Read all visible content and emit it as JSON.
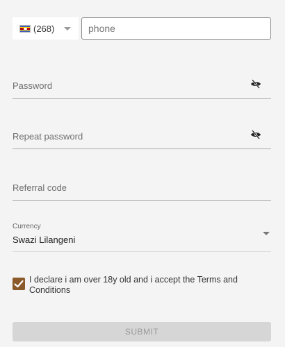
{
  "phone": {
    "country_code": "(268)",
    "flag_icon": "eswatini-flag-icon",
    "placeholder": "phone"
  },
  "password": {
    "placeholder": "Password",
    "toggle_icon": "eye-slash-icon"
  },
  "repeat_password": {
    "placeholder": "Repeat password",
    "toggle_icon": "eye-slash-icon"
  },
  "referral": {
    "placeholder": "Referral code"
  },
  "currency": {
    "label": "Currency",
    "value": "Swazi Lilangeni"
  },
  "declaration": {
    "checked": true,
    "text": "I declare i am over 18y old and i accept the Terms and Conditions"
  },
  "submit": {
    "label": "SUBMIT"
  },
  "colors": {
    "checkbox": "#8b5a2b",
    "submit_bg": "#d6d6d6",
    "submit_text": "#9a9a9a",
    "background": "#f4f4f4"
  }
}
